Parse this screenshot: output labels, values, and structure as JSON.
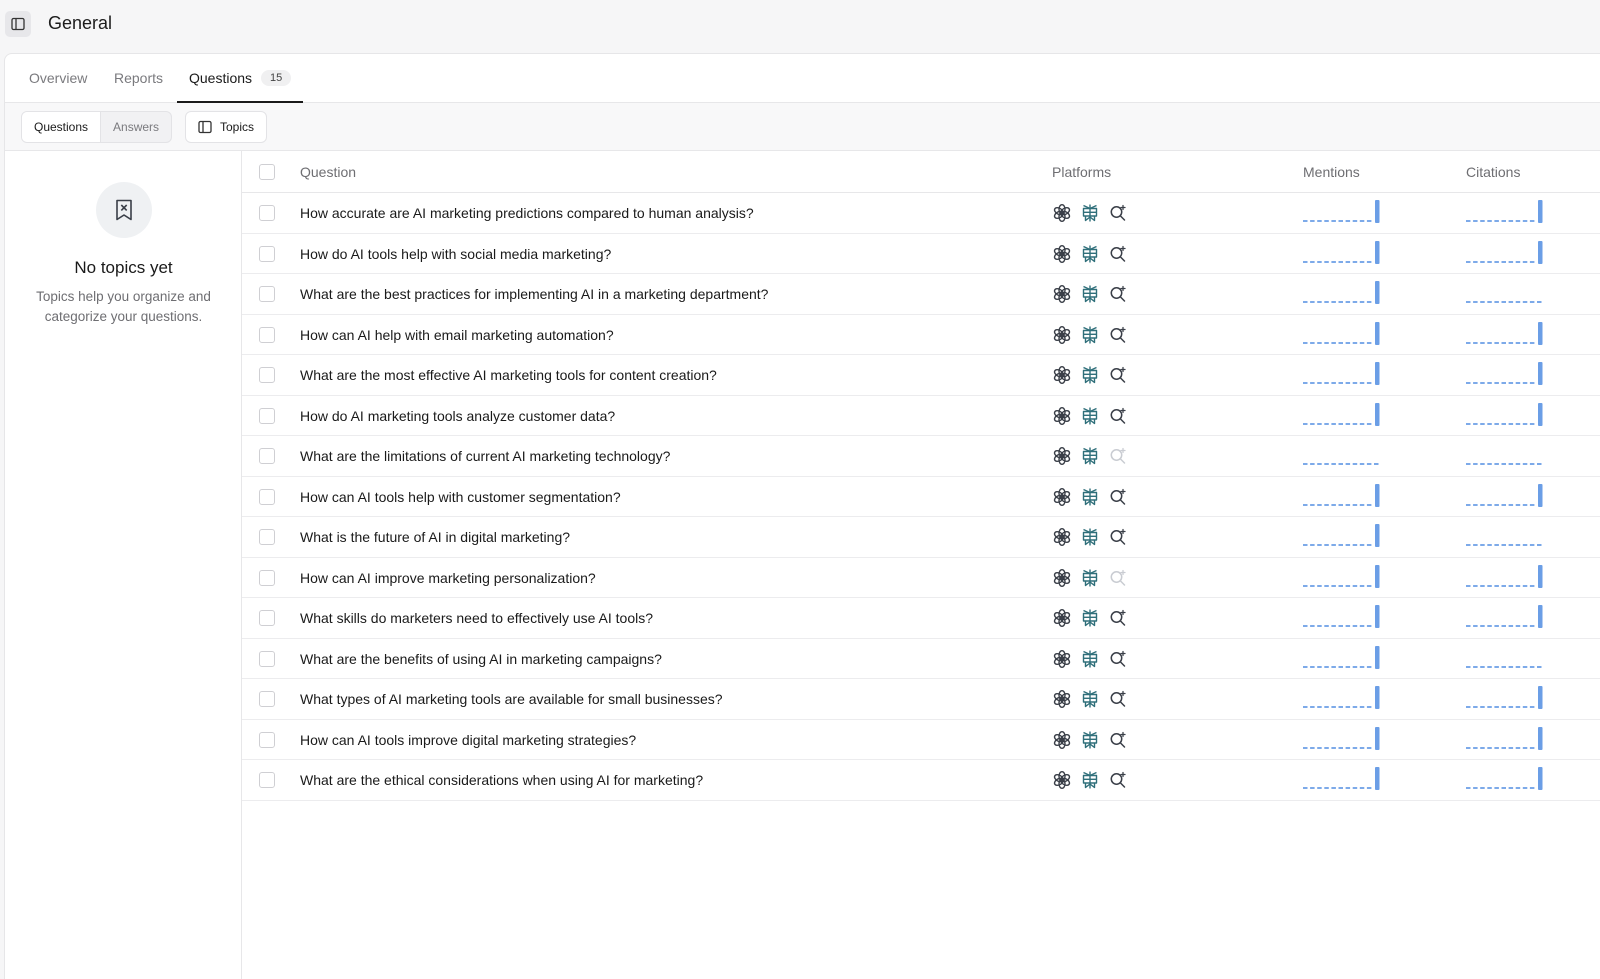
{
  "header": {
    "title": "General"
  },
  "tabs": [
    {
      "label": "Overview"
    },
    {
      "label": "Reports"
    },
    {
      "label": "Questions",
      "count": "15"
    }
  ],
  "toolbar": {
    "questions_label": "Questions",
    "answers_label": "Answers",
    "topics_label": "Topics"
  },
  "topics_panel": {
    "title": "No topics yet",
    "description": "Topics help you organize and categorize your questions."
  },
  "table": {
    "columns": {
      "question": "Question",
      "platforms": "Platforms",
      "mentions": "Mentions",
      "citations": "Citations"
    },
    "platform_icons": [
      "openai-icon",
      "perplexity-icon",
      "ai-search-icon"
    ],
    "rows": [
      {
        "question": "How accurate are AI marketing predictions compared to human analysis?",
        "platforms": [
          true,
          true,
          true
        ],
        "mentions_latest": 1,
        "citations_latest": 1
      },
      {
        "question": "How do AI tools help with social media marketing?",
        "platforms": [
          true,
          true,
          true
        ],
        "mentions_latest": 1,
        "citations_latest": 1
      },
      {
        "question": "What are the best practices for implementing AI in a marketing department?",
        "platforms": [
          true,
          true,
          true
        ],
        "mentions_latest": 1,
        "citations_latest": 0
      },
      {
        "question": "How can AI help with email marketing automation?",
        "platforms": [
          true,
          true,
          true
        ],
        "mentions_latest": 1,
        "citations_latest": 1
      },
      {
        "question": "What are the most effective AI marketing tools for content creation?",
        "platforms": [
          true,
          true,
          true
        ],
        "mentions_latest": 1,
        "citations_latest": 1
      },
      {
        "question": "How do AI marketing tools analyze customer data?",
        "platforms": [
          true,
          true,
          true
        ],
        "mentions_latest": 1,
        "citations_latest": 1
      },
      {
        "question": "What are the limitations of current AI marketing technology?",
        "platforms": [
          true,
          true,
          false
        ],
        "mentions_latest": 0,
        "citations_latest": 0
      },
      {
        "question": "How can AI tools help with customer segmentation?",
        "platforms": [
          true,
          true,
          true
        ],
        "mentions_latest": 1,
        "citations_latest": 1
      },
      {
        "question": "What is the future of AI in digital marketing?",
        "platforms": [
          true,
          true,
          true
        ],
        "mentions_latest": 1,
        "citations_latest": 0
      },
      {
        "question": "How can AI improve marketing personalization?",
        "platforms": [
          true,
          true,
          false
        ],
        "mentions_latest": 1,
        "citations_latest": 1
      },
      {
        "question": "What skills do marketers need to effectively use AI tools?",
        "platforms": [
          true,
          true,
          true
        ],
        "mentions_latest": 1,
        "citations_latest": 1
      },
      {
        "question": "What are the benefits of using AI in marketing campaigns?",
        "platforms": [
          true,
          true,
          true
        ],
        "mentions_latest": 1,
        "citations_latest": 0
      },
      {
        "question": "What types of AI marketing tools are available for small businesses?",
        "platforms": [
          true,
          true,
          true
        ],
        "mentions_latest": 1,
        "citations_latest": 1
      },
      {
        "question": "How can AI tools improve digital marketing strategies?",
        "platforms": [
          true,
          true,
          true
        ],
        "mentions_latest": 1,
        "citations_latest": 1
      },
      {
        "question": "What are the ethical considerations when using AI for marketing?",
        "platforms": [
          true,
          true,
          true
        ],
        "mentions_latest": 1,
        "citations_latest": 1
      }
    ]
  },
  "colors": {
    "accent_blue": "#6b9ee6",
    "icon_dark": "#3a3f48",
    "icon_teal": "#2f6f7a",
    "icon_disabled": "#c9ccd2"
  }
}
